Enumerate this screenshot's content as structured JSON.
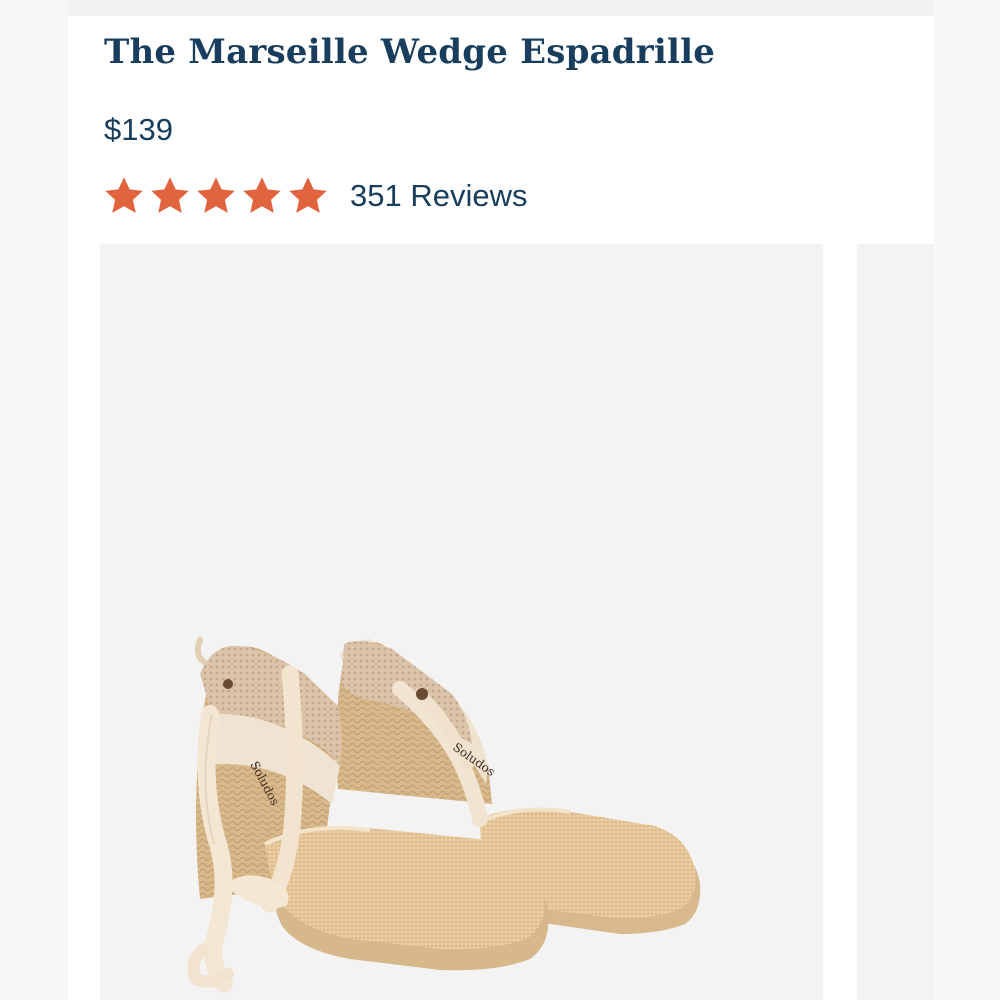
{
  "product": {
    "title": "The Marseille Wedge Espadrille",
    "price": "$139",
    "rating": {
      "stars_filled": 5,
      "stars_total": 5,
      "reviews_label": "351 Reviews"
    },
    "image": {
      "alt": "Pair of natural jute wedge espadrilles with cream ankle ties",
      "label_left": "Soludos",
      "label_right": "Soludos"
    }
  },
  "colors": {
    "title": "#183d5d",
    "star": "#e2643e",
    "image_bg": "#f3f3f4"
  }
}
